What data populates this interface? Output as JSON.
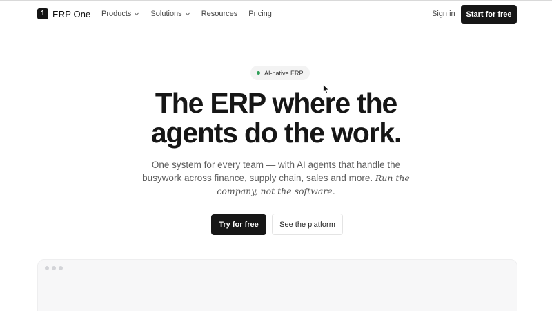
{
  "brand": {
    "mark": "1",
    "name": "ERP One"
  },
  "nav": {
    "links": [
      {
        "label": "Products",
        "has_dropdown": true
      },
      {
        "label": "Solutions",
        "has_dropdown": true
      },
      {
        "label": "Resources",
        "has_dropdown": false
      },
      {
        "label": "Pricing",
        "has_dropdown": false
      }
    ],
    "sign_in": "Sign in",
    "start_free": "Start for free"
  },
  "hero": {
    "badge": "AI-native ERP",
    "title_line1": "The ERP where the",
    "title_line2": "agents do the work.",
    "subtitle_line1": "One system for every team — with AI agents that handle the",
    "subtitle_line2_plain": "busywork across finance, supply chain, sales and more.",
    "subtitle_line2_italic": "Run the",
    "subtitle_line3_italic": "company, not the software.",
    "primary_cta": "Try for free",
    "secondary_cta": "See the platform"
  },
  "colors": {
    "primary": "#161616",
    "badge_dot": "#2f9e58",
    "muted_text": "#5d5d5d"
  },
  "icons": {
    "dropdown": "chevron-down-icon",
    "cursor": "mouse-pointer-icon"
  }
}
